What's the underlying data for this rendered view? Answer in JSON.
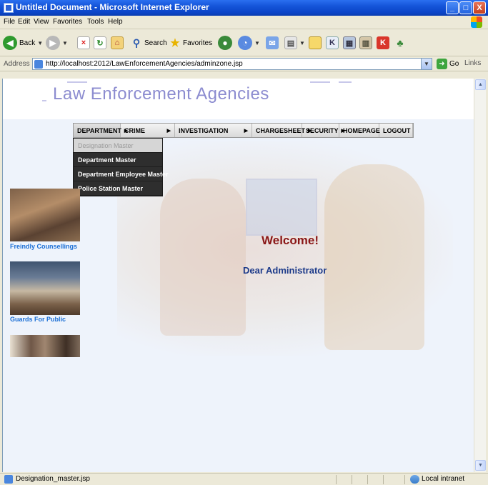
{
  "window": {
    "title": "Untitled Document - Microsoft Internet Explorer",
    "min_glyph": "_",
    "max_glyph": "□",
    "close_glyph": "X"
  },
  "menubar": [
    "File",
    "Edit",
    "View",
    "Favorites",
    "Tools",
    "Help"
  ],
  "toolbar": {
    "back": "Back",
    "search": "Search",
    "favorites": "Favorites"
  },
  "address": {
    "label": "Address",
    "url": "http://localhost:2012/LawEnforcementAgencies/adminzone.jsp",
    "go": "Go",
    "links": "Links"
  },
  "page": {
    "site_title": "Law Enforcement Agencies",
    "nav": [
      {
        "label": "DEPARTMENT",
        "arrow": "▶"
      },
      {
        "label": "CRIME",
        "arrow": "▶"
      },
      {
        "label": "INVESTIGATION",
        "arrow": "▶"
      },
      {
        "label": "CHARGESHEET",
        "arrow": "▶"
      },
      {
        "label": "SECURITY",
        "arrow": "▶"
      },
      {
        "label": "HOMEPAGE",
        "arrow": ""
      },
      {
        "label": "LOGOUT",
        "arrow": ""
      }
    ],
    "dropdown": [
      "Designation Master",
      "Department Master",
      "Department Employee Master",
      "Police Station Master"
    ],
    "side_captions": [
      "Freindly Counsellings",
      "Guards For Public"
    ],
    "welcome": "Welcome!",
    "greeting": "Dear Administrator"
  },
  "status": {
    "text": "Designation_master.jsp",
    "zone": "Local intranet"
  },
  "colors": {
    "titlebar": "#0b45c8",
    "site_title": "#8c8cd0",
    "welcome": "#8a1717",
    "greeting": "#1d3b8a",
    "caption": "#1b6fd6",
    "dropdown_bg": "#2e2e2e"
  }
}
